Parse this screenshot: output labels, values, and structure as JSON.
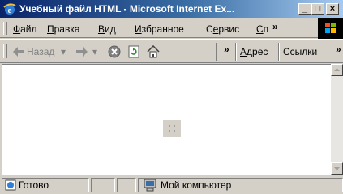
{
  "window": {
    "title": "Учебный файл HTML - Microsoft Internet Ex...",
    "minimize": "_",
    "maximize": "□",
    "close": "×"
  },
  "menu": {
    "items": [
      {
        "underline": "Ф",
        "rest": "айл"
      },
      {
        "underline": "П",
        "rest": "равка"
      },
      {
        "underline": "В",
        "rest": "ид"
      },
      {
        "underline": "И",
        "rest": "збранное"
      },
      {
        "pre": "С",
        "underline": "е",
        "rest": "рвис"
      },
      {
        "underline": "С",
        "rest": "п"
      }
    ],
    "overflow": "»"
  },
  "toolbar": {
    "back_label": "Назад",
    "dropdown_glyph": "▾",
    "overflow": "»",
    "address_label": {
      "underline": "А",
      "rest": "дрес"
    },
    "links_label": "Ссылки",
    "links_overflow": "»"
  },
  "status": {
    "ready": "Готово",
    "zone": "Мой компьютер"
  },
  "icons": [
    "ie-icon",
    "back-arrow-icon",
    "forward-arrow-icon",
    "stop-icon",
    "refresh-icon",
    "home-icon",
    "windows-logo-icon",
    "placeholder-image-icon",
    "computer-icon"
  ]
}
